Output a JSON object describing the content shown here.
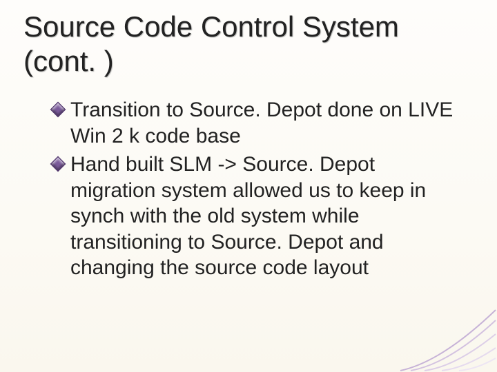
{
  "title": {
    "line1": "Source Code Control System",
    "line2": "(cont. )"
  },
  "bullets": [
    "Transition to Source. Depot done on LIVE Win 2 k code base",
    "Hand built SLM -> Source. Depot migration system allowed us to keep in synch with the old system while transitioning to Source. Depot and changing the source code layout"
  ],
  "theme": {
    "accent": "#7a5a9a",
    "accent_soft": "#cdb9dd"
  }
}
